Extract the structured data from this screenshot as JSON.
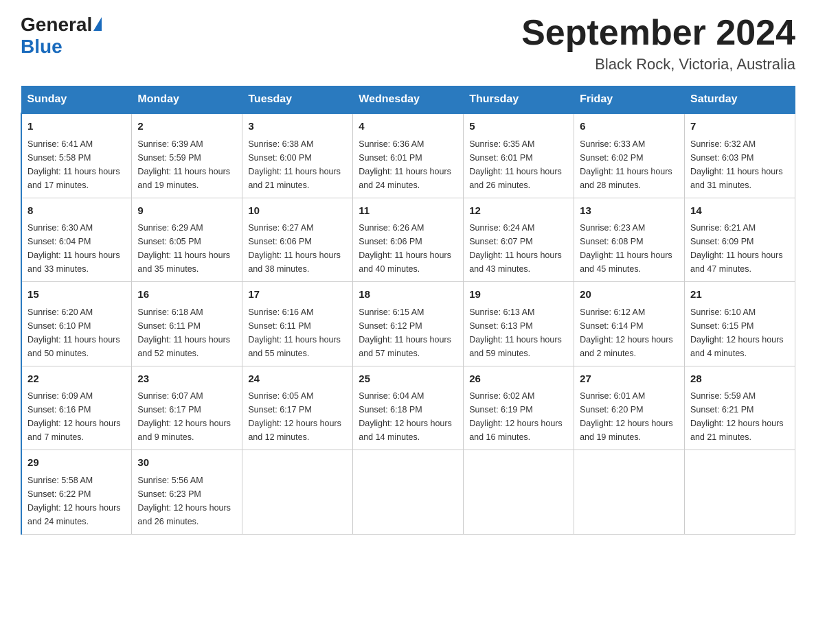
{
  "header": {
    "logo_general": "General",
    "logo_blue": "Blue",
    "title": "September 2024",
    "subtitle": "Black Rock, Victoria, Australia"
  },
  "days_of_week": [
    "Sunday",
    "Monday",
    "Tuesday",
    "Wednesday",
    "Thursday",
    "Friday",
    "Saturday"
  ],
  "weeks": [
    [
      {
        "day": "1",
        "sunrise": "6:41 AM",
        "sunset": "5:58 PM",
        "daylight": "11 hours and 17 minutes."
      },
      {
        "day": "2",
        "sunrise": "6:39 AM",
        "sunset": "5:59 PM",
        "daylight": "11 hours and 19 minutes."
      },
      {
        "day": "3",
        "sunrise": "6:38 AM",
        "sunset": "6:00 PM",
        "daylight": "11 hours and 21 minutes."
      },
      {
        "day": "4",
        "sunrise": "6:36 AM",
        "sunset": "6:01 PM",
        "daylight": "11 hours and 24 minutes."
      },
      {
        "day": "5",
        "sunrise": "6:35 AM",
        "sunset": "6:01 PM",
        "daylight": "11 hours and 26 minutes."
      },
      {
        "day": "6",
        "sunrise": "6:33 AM",
        "sunset": "6:02 PM",
        "daylight": "11 hours and 28 minutes."
      },
      {
        "day": "7",
        "sunrise": "6:32 AM",
        "sunset": "6:03 PM",
        "daylight": "11 hours and 31 minutes."
      }
    ],
    [
      {
        "day": "8",
        "sunrise": "6:30 AM",
        "sunset": "6:04 PM",
        "daylight": "11 hours and 33 minutes."
      },
      {
        "day": "9",
        "sunrise": "6:29 AM",
        "sunset": "6:05 PM",
        "daylight": "11 hours and 35 minutes."
      },
      {
        "day": "10",
        "sunrise": "6:27 AM",
        "sunset": "6:06 PM",
        "daylight": "11 hours and 38 minutes."
      },
      {
        "day": "11",
        "sunrise": "6:26 AM",
        "sunset": "6:06 PM",
        "daylight": "11 hours and 40 minutes."
      },
      {
        "day": "12",
        "sunrise": "6:24 AM",
        "sunset": "6:07 PM",
        "daylight": "11 hours and 43 minutes."
      },
      {
        "day": "13",
        "sunrise": "6:23 AM",
        "sunset": "6:08 PM",
        "daylight": "11 hours and 45 minutes."
      },
      {
        "day": "14",
        "sunrise": "6:21 AM",
        "sunset": "6:09 PM",
        "daylight": "11 hours and 47 minutes."
      }
    ],
    [
      {
        "day": "15",
        "sunrise": "6:20 AM",
        "sunset": "6:10 PM",
        "daylight": "11 hours and 50 minutes."
      },
      {
        "day": "16",
        "sunrise": "6:18 AM",
        "sunset": "6:11 PM",
        "daylight": "11 hours and 52 minutes."
      },
      {
        "day": "17",
        "sunrise": "6:16 AM",
        "sunset": "6:11 PM",
        "daylight": "11 hours and 55 minutes."
      },
      {
        "day": "18",
        "sunrise": "6:15 AM",
        "sunset": "6:12 PM",
        "daylight": "11 hours and 57 minutes."
      },
      {
        "day": "19",
        "sunrise": "6:13 AM",
        "sunset": "6:13 PM",
        "daylight": "11 hours and 59 minutes."
      },
      {
        "day": "20",
        "sunrise": "6:12 AM",
        "sunset": "6:14 PM",
        "daylight": "12 hours and 2 minutes."
      },
      {
        "day": "21",
        "sunrise": "6:10 AM",
        "sunset": "6:15 PM",
        "daylight": "12 hours and 4 minutes."
      }
    ],
    [
      {
        "day": "22",
        "sunrise": "6:09 AM",
        "sunset": "6:16 PM",
        "daylight": "12 hours and 7 minutes."
      },
      {
        "day": "23",
        "sunrise": "6:07 AM",
        "sunset": "6:17 PM",
        "daylight": "12 hours and 9 minutes."
      },
      {
        "day": "24",
        "sunrise": "6:05 AM",
        "sunset": "6:17 PM",
        "daylight": "12 hours and 12 minutes."
      },
      {
        "day": "25",
        "sunrise": "6:04 AM",
        "sunset": "6:18 PM",
        "daylight": "12 hours and 14 minutes."
      },
      {
        "day": "26",
        "sunrise": "6:02 AM",
        "sunset": "6:19 PM",
        "daylight": "12 hours and 16 minutes."
      },
      {
        "day": "27",
        "sunrise": "6:01 AM",
        "sunset": "6:20 PM",
        "daylight": "12 hours and 19 minutes."
      },
      {
        "day": "28",
        "sunrise": "5:59 AM",
        "sunset": "6:21 PM",
        "daylight": "12 hours and 21 minutes."
      }
    ],
    [
      {
        "day": "29",
        "sunrise": "5:58 AM",
        "sunset": "6:22 PM",
        "daylight": "12 hours and 24 minutes."
      },
      {
        "day": "30",
        "sunrise": "5:56 AM",
        "sunset": "6:23 PM",
        "daylight": "12 hours and 26 minutes."
      },
      null,
      null,
      null,
      null,
      null
    ]
  ],
  "labels": {
    "sunrise": "Sunrise:",
    "sunset": "Sunset:",
    "daylight": "Daylight:"
  }
}
